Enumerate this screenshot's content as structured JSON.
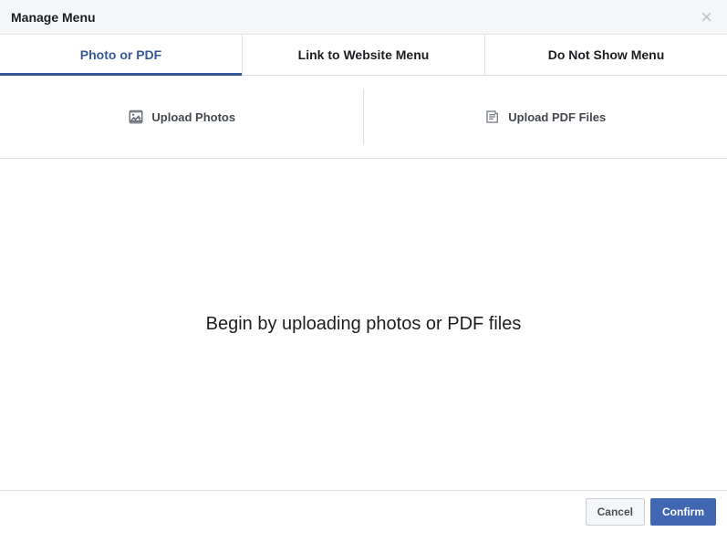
{
  "header": {
    "title": "Manage Menu"
  },
  "tabs": [
    {
      "label": "Photo or PDF",
      "active": true
    },
    {
      "label": "Link to Website Menu",
      "active": false
    },
    {
      "label": "Do Not Show Menu",
      "active": false
    }
  ],
  "upload": {
    "photos_label": "Upload Photos",
    "pdf_label": "Upload PDF Files"
  },
  "main": {
    "empty_message": "Begin by uploading photos or PDF files"
  },
  "footer": {
    "cancel_label": "Cancel",
    "confirm_label": "Confirm"
  }
}
